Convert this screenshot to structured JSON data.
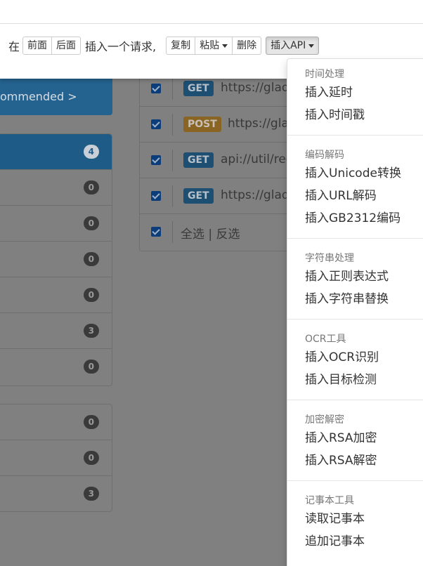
{
  "background": {
    "recommended_text": "ommended >",
    "sidebar_counts_1": [
      "4",
      "0",
      "0",
      "0",
      "0",
      "3",
      "0"
    ],
    "sidebar_counts_2": [
      "0",
      "0",
      "3"
    ],
    "requests": [
      {
        "method": "GET",
        "url": "https://glado"
      },
      {
        "method": "POST",
        "url": "https://glad"
      },
      {
        "method": "GET",
        "url": "api://util/rege"
      },
      {
        "method": "GET",
        "url": "https://glado"
      }
    ],
    "select_all": "全选 | 反选"
  },
  "toolbar": {
    "prefix": "在",
    "before": "前面",
    "after": "后面",
    "middle": "插入一个请求,",
    "copy": "复制",
    "paste": "粘贴",
    "delete": "删除",
    "insert_api": "插入API"
  },
  "dropdown": {
    "groups": [
      {
        "header": "时间处理",
        "items": [
          "插入延时",
          "插入时间戳"
        ]
      },
      {
        "header": "编码解码",
        "items": [
          "插入Unicode转换",
          "插入URL解码",
          "插入GB2312编码"
        ]
      },
      {
        "header": "字符串处理",
        "items": [
          "插入正则表达式",
          "插入字符串替换"
        ]
      },
      {
        "header": "OCR工具",
        "items": [
          "插入OCR识别",
          "插入目标检测"
        ]
      },
      {
        "header": "加密解密",
        "items": [
          "插入RSA加密",
          "插入RSA解密"
        ]
      },
      {
        "header": "记事本工具",
        "items": [
          "读取记事本",
          "追加记事本"
        ]
      }
    ]
  }
}
